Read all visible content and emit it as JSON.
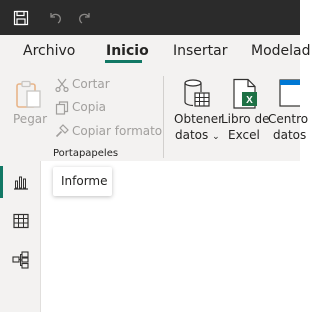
{
  "colors": {
    "titlebar": "#2b2b2b",
    "ribbon": "#f3f2f1",
    "accent": "#117865",
    "excel_green": "#1e7145"
  },
  "titlebar": {
    "icons": [
      "save-icon",
      "undo-icon",
      "redo-icon"
    ]
  },
  "tabs": [
    {
      "label": "Archivo"
    },
    {
      "label": "Inicio",
      "active": true
    },
    {
      "label": "Insertar"
    },
    {
      "label": "Modelad"
    }
  ],
  "ribbon": {
    "clipboard": {
      "paste_label": "Pegar",
      "cut_label": "Cortar",
      "copy_label": "Copia",
      "format_label": "Copiar formato",
      "group_label": "Portapapeles"
    },
    "data": {
      "get_data_line1": "Obtener",
      "get_data_line2": "datos",
      "excel_line1": "Libro de",
      "excel_line2": "Excel",
      "center_line1": "Centro",
      "center_line2": "datos"
    }
  },
  "leftnav": {
    "items": [
      "report-view-icon",
      "table-view-icon",
      "model-view-icon"
    ],
    "tooltip": "Informe"
  }
}
